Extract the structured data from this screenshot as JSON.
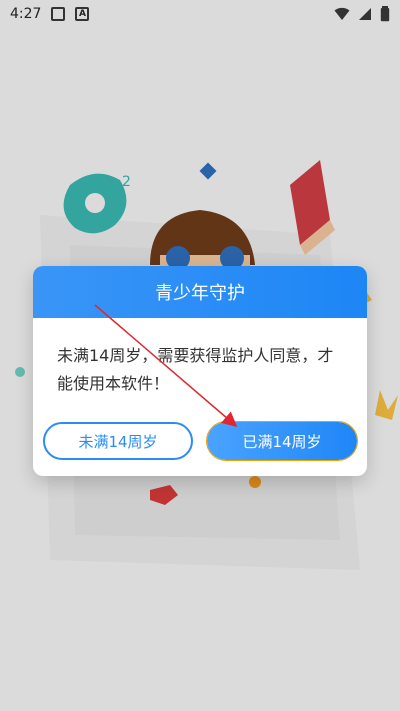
{
  "status_bar": {
    "time": "4:27",
    "icons": [
      "image-icon",
      "a-icon",
      "wifi-icon",
      "signal-icon",
      "battery-icon"
    ],
    "a_label": "A"
  },
  "dialog": {
    "title": "青少年守护",
    "message": "未满14周岁，需要获得监护人同意，才能使用本软件！",
    "buttons": {
      "under_14": "未满14周岁",
      "over_14": "已满14周岁"
    }
  },
  "colors": {
    "accent": "#1d86f5",
    "arrow": "#e0262e"
  }
}
